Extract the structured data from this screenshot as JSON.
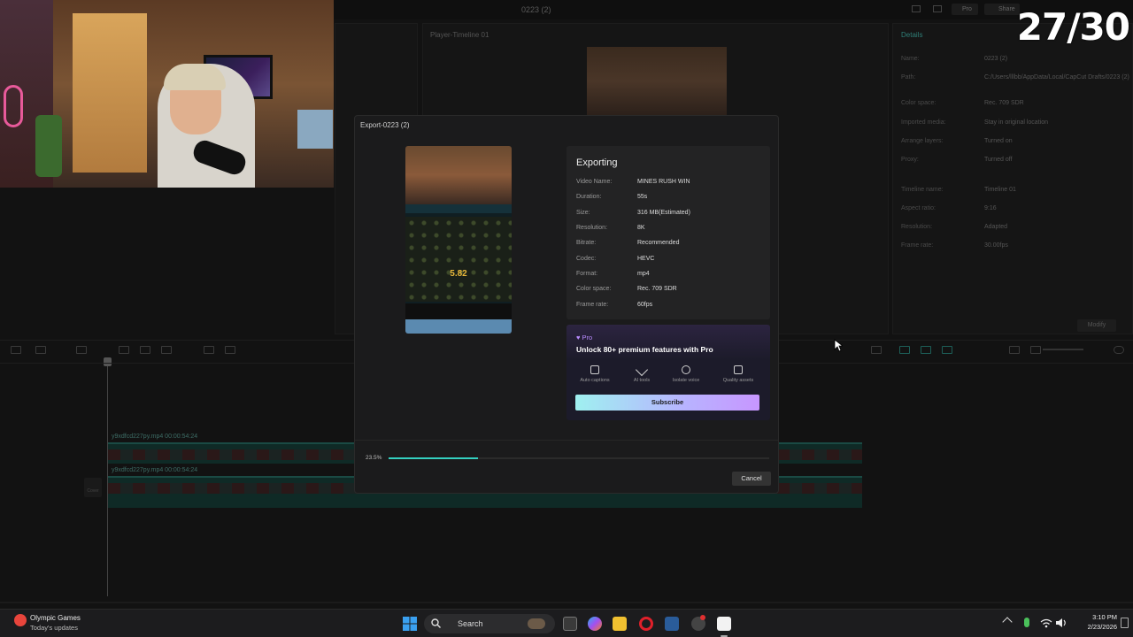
{
  "app": {
    "window_title": "0223 (2)",
    "player_label": "Player-Timeline 01",
    "pro_label": "Pro",
    "share_label": "Share",
    "details": {
      "title": "Details",
      "rows": [
        {
          "key": "Name:",
          "value": "0223 (2)"
        },
        {
          "key": "Path:",
          "value": "C:/Users/lllbb/AppData/Local/CapCut Drafts/0223 (2)"
        },
        {
          "key": "Color space:",
          "value": "Rec. 709 SDR"
        },
        {
          "key": "Imported media:",
          "value": "Stay in original location"
        },
        {
          "key": "Arrange layers:",
          "value": "Turned on"
        },
        {
          "key": "Proxy:",
          "value": "Turned off"
        },
        {
          "key": "Timeline name:",
          "value": "Timeline 01"
        },
        {
          "key": "Aspect ratio:",
          "value": "9:16"
        },
        {
          "key": "Resolution:",
          "value": "Adapted"
        },
        {
          "key": "Frame rate:",
          "value": "30.00fps"
        }
      ],
      "modify_label": "Modify"
    },
    "clips": [
      "y9xdfcd227py.mp4  00:00:54:24",
      "y9xdfcd227py.mp4  00:00:54:24"
    ],
    "cover_label": "Cover"
  },
  "counter": "27/30",
  "dialog": {
    "title": "Export-0223 (2)",
    "thumb_multiplier": "5.82",
    "heading": "Exporting",
    "rows": [
      {
        "key": "Video Name:",
        "value": "MINES RUSH WIN"
      },
      {
        "key": "Duration:",
        "value": "55s"
      },
      {
        "key": "Size:",
        "value": "316 MB(Estimated)"
      },
      {
        "key": "Resolution:",
        "value": "8K"
      },
      {
        "key": "Bitrate:",
        "value": "Recommended"
      },
      {
        "key": "Codec:",
        "value": "HEVC"
      },
      {
        "key": "Format:",
        "value": "mp4"
      },
      {
        "key": "Color space:",
        "value": "Rec. 709 SDR"
      },
      {
        "key": "Frame rate:",
        "value": "60fps"
      }
    ],
    "promo": {
      "badge": "♥ Pro",
      "headline": "Unlock 80+ premium features with Pro",
      "features": [
        {
          "icon": "captions-icon",
          "label": "Auto captions"
        },
        {
          "icon": "ai-tools-icon",
          "label": "AI tools"
        },
        {
          "icon": "isolate-voice-icon",
          "label": "Isolate voice"
        },
        {
          "icon": "quality-assets-icon",
          "label": "Quality assets"
        }
      ],
      "subscribe_label": "Subscribe"
    },
    "progress_text": "23.5%",
    "progress": 0.235,
    "cancel_label": "Cancel"
  },
  "taskbar": {
    "news_title": "Olympic Games",
    "news_subtitle": "Today's updates",
    "search_label": "Search",
    "time": "3:10 PM",
    "date": "2/23/2026"
  },
  "colors": {
    "accent": "#34d0c0",
    "pro": "#b98bff",
    "counter": "#ffffff"
  }
}
